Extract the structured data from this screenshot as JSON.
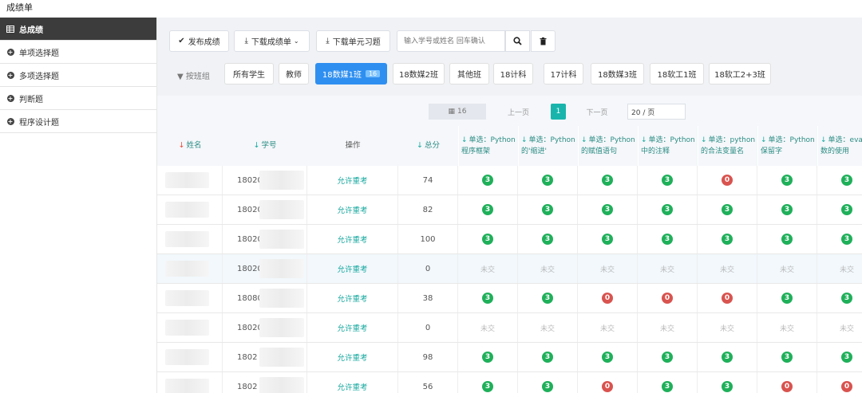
{
  "page": {
    "title": "成绩单"
  },
  "sidebar": {
    "items": [
      {
        "label": "总成绩",
        "icon": "table-icon",
        "active": true
      },
      {
        "label": "单项选择题",
        "icon": "plus-circle-icon"
      },
      {
        "label": "多项选择题",
        "icon": "plus-circle-icon"
      },
      {
        "label": "判断题",
        "icon": "plus-circle-icon"
      },
      {
        "label": "程序设计题",
        "icon": "plus-circle-icon"
      }
    ]
  },
  "toolbar": {
    "publish_label": "发布成绩",
    "download_scores_label": "下载成绩单",
    "download_unit_label": "下载单元习题",
    "search_placeholder": "输入学号或姓名 回车确认"
  },
  "filter": {
    "label": "按班组",
    "classes": [
      {
        "label": "所有学生"
      },
      {
        "label": "教师"
      },
      {
        "label": "18数媒1班",
        "count": "16",
        "active": true
      },
      {
        "label": "18数媒2班"
      },
      {
        "label": "其他班"
      },
      {
        "label": "18计科"
      },
      {
        "label": "17计科"
      },
      {
        "label": "18数媒3班"
      },
      {
        "label": "18软工1班"
      },
      {
        "label": "18软工2+3班"
      }
    ]
  },
  "pager": {
    "total": "16",
    "prev": "上一页",
    "current": "1",
    "next": "下一页",
    "page_size": "20 / 页"
  },
  "table": {
    "headers": {
      "name": "姓名",
      "id": "学号",
      "action": "操作",
      "total": "总分",
      "questions": [
        {
          "line1": "单选：Python",
          "line2": "程序框架"
        },
        {
          "line1": "单选：Python",
          "line2": "的'缩进'"
        },
        {
          "line1": "单选：Python",
          "line2": "的赋值语句"
        },
        {
          "line1": "单选：Python",
          "line2": "中的注释"
        },
        {
          "line1": "单选：python",
          "line2": "的合法变量名"
        },
        {
          "line1": "单选：Python",
          "line2": "保留字"
        },
        {
          "line1": "单选：eva",
          "line2": "数的使用"
        }
      ]
    },
    "rows": [
      {
        "id": "18020",
        "action": "允许重考",
        "total": "74",
        "marks": [
          "3",
          "3",
          "3",
          "3",
          "0",
          "3",
          "3"
        ]
      },
      {
        "id": "18020",
        "action": "允许重考",
        "total": "82",
        "marks": [
          "3",
          "3",
          "3",
          "3",
          "3",
          "3",
          "3"
        ]
      },
      {
        "id": "18020",
        "action": "允许重考",
        "total": "100",
        "marks": [
          "3",
          "3",
          "3",
          "3",
          "3",
          "3",
          "3"
        ]
      },
      {
        "id": "18020",
        "action": "允许重考",
        "total": "0",
        "marks": [
          "未交",
          "未交",
          "未交",
          "未交",
          "未交",
          "未交",
          "未交"
        ],
        "highlight": true
      },
      {
        "id": "18080",
        "action": "允许重考",
        "total": "38",
        "marks": [
          "3",
          "3",
          "0",
          "0",
          "0",
          "3",
          "3"
        ]
      },
      {
        "id": "18020",
        "action": "允许重考",
        "total": "0",
        "marks": [
          "未交",
          "未交",
          "未交",
          "未交",
          "未交",
          "未交",
          "未交"
        ]
      },
      {
        "id": "1802",
        "action": "允许重考",
        "total": "98",
        "marks": [
          "3",
          "3",
          "3",
          "3",
          "3",
          "3",
          "3"
        ]
      },
      {
        "id": "1802",
        "action": "允许重考",
        "total": "56",
        "marks": [
          "3",
          "3",
          "0",
          "3",
          "3",
          "0",
          "0"
        ]
      }
    ]
  },
  "colors": {
    "accent": "#2f8ff0",
    "teal": "#19a9a0",
    "correct": "#1fb05a",
    "wrong": "#d9534f"
  }
}
